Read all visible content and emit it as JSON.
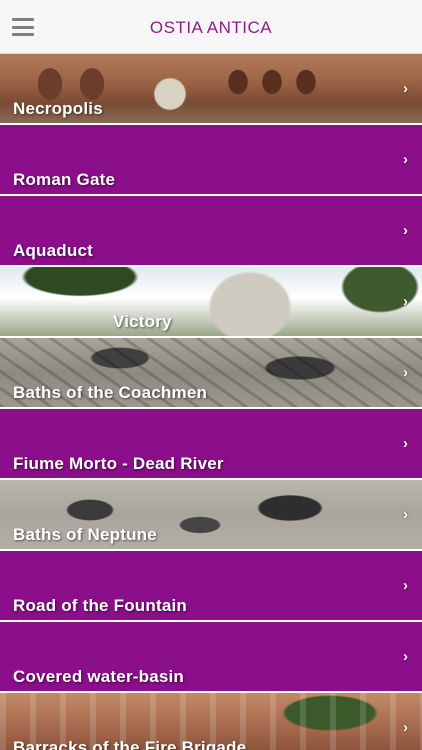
{
  "header": {
    "title": "OSTIA ANTICA",
    "menu_icon": "hamburger-menu-icon"
  },
  "colors": {
    "accent": "#8b0e8b",
    "title": "#8a1e86"
  },
  "list": {
    "chevron": "›",
    "items": [
      {
        "label": "Necropolis",
        "style": "image",
        "image": "ruins-arches"
      },
      {
        "label": "Roman Gate",
        "style": "purple"
      },
      {
        "label": "Aquaduct",
        "style": "purple"
      },
      {
        "label": "Victory",
        "style": "image",
        "image": "statue-victory"
      },
      {
        "label": "Baths of the Coachmen",
        "style": "image",
        "image": "mosaic-floor"
      },
      {
        "label": "Fiume Morto - Dead River",
        "style": "purple"
      },
      {
        "label": "Baths of Neptune",
        "style": "image",
        "image": "mosaic-neptune"
      },
      {
        "label": "Road of the Fountain",
        "style": "purple"
      },
      {
        "label": "Covered water-basin",
        "style": "purple"
      },
      {
        "label": "Barracks of the Fire Brigade",
        "style": "image",
        "image": "barracks-ruins"
      }
    ]
  }
}
